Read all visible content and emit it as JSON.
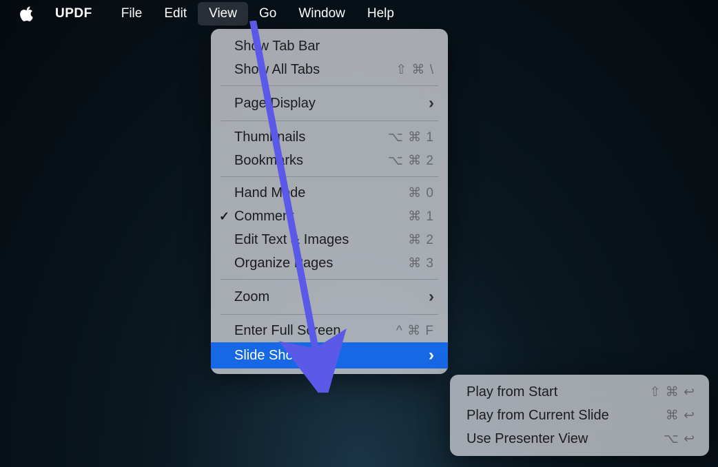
{
  "menubar": {
    "app_name": "UPDF",
    "items": [
      "File",
      "Edit",
      "View",
      "Go",
      "Window",
      "Help"
    ],
    "active_index": 2
  },
  "dropdown": {
    "groups": [
      [
        {
          "label": "Show Tab Bar",
          "shortcut": "",
          "submenu": false,
          "check": false
        },
        {
          "label": "Show All Tabs",
          "shortcut": "⇧ ⌘ \\",
          "submenu": false,
          "check": false
        }
      ],
      [
        {
          "label": "Page Display",
          "shortcut": "",
          "submenu": true,
          "check": false
        }
      ],
      [
        {
          "label": "Thumbnails",
          "shortcut": "⌥ ⌘ 1",
          "submenu": false,
          "check": false
        },
        {
          "label": "Bookmarks",
          "shortcut": "⌥ ⌘ 2",
          "submenu": false,
          "check": false
        }
      ],
      [
        {
          "label": "Hand Mode",
          "shortcut": "⌘ 0",
          "submenu": false,
          "check": false
        },
        {
          "label": "Comment",
          "shortcut": "⌘ 1",
          "submenu": false,
          "check": true
        },
        {
          "label": "Edit Text & Images",
          "shortcut": "⌘ 2",
          "submenu": false,
          "check": false
        },
        {
          "label": "Organize Pages",
          "shortcut": "⌘ 3",
          "submenu": false,
          "check": false
        }
      ],
      [
        {
          "label": "Zoom",
          "shortcut": "",
          "submenu": true,
          "check": false
        }
      ],
      [
        {
          "label": "Enter Full Screen",
          "shortcut": "^ ⌘ F",
          "submenu": false,
          "check": false
        },
        {
          "label": "Slide Show",
          "shortcut": "",
          "submenu": true,
          "check": false,
          "highlight": true
        }
      ]
    ]
  },
  "submenu": {
    "items": [
      {
        "label": "Play from Start",
        "shortcut": "⇧ ⌘ ↩"
      },
      {
        "label": "Play from Current Slide",
        "shortcut": "⌘ ↩"
      },
      {
        "label": "Use Presenter View",
        "shortcut": "⌥ ↩"
      }
    ]
  }
}
